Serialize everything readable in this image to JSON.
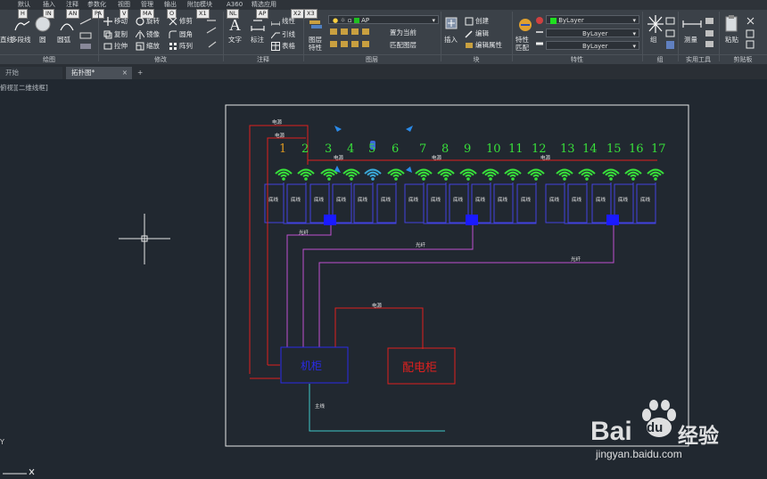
{
  "ribbon": {
    "tabs": [
      "默认",
      "插入",
      "注释",
      "参数化",
      "视图",
      "管理",
      "输出",
      "附加模块",
      "A360",
      "精选应用"
    ],
    "key_badges": [
      "H",
      "IN",
      "AN",
      "PA",
      "V",
      "MA",
      "O",
      "X1",
      "NL",
      "AP",
      "X2",
      "X3"
    ],
    "draw": {
      "line": "直线",
      "polyline": "多段线",
      "circle": "圆",
      "arc": "圆弧"
    },
    "modify": {
      "move": "移动",
      "rotate": "旋转",
      "trim": "修剪",
      "copy": "复制",
      "mirror": "镜像",
      "fillet": "圆角",
      "stretch": "拉伸",
      "scale": "缩放",
      "array": "阵列"
    },
    "annotation": {
      "text": "文字",
      "dimension": "标注",
      "linear": "线性",
      "leader": "引线",
      "table": "表格"
    },
    "layers": {
      "layer_props": "图层特性",
      "current_layer": "AP",
      "set_current": "置为当前",
      "match_layer": "匹配图层"
    },
    "block": {
      "insert": "插入",
      "create": "创建",
      "edit": "编辑",
      "edit_attr": "编辑属性"
    },
    "properties": {
      "match_props": "特性匹配",
      "color": "ByLayer",
      "linetype": "ByLayer",
      "lineweight": "ByLayer"
    },
    "extra": {
      "group": "组",
      "measure": "测量",
      "paste": "粘贴"
    },
    "sections": [
      "绘图",
      "修改",
      "注释",
      "图层",
      "块",
      "特性",
      "组",
      "实用工具",
      "剪贴板"
    ]
  },
  "doc_tabs": {
    "start": "开始",
    "current": "拓扑图*",
    "add": "+"
  },
  "viewport_label": "俯视][二维线框]",
  "drawing": {
    "ap_numbers": [
      "1",
      "2",
      "3",
      "4",
      "5",
      "6",
      "7",
      "8",
      "9",
      "10",
      "11",
      "12",
      "13",
      "14",
      "15",
      "16",
      "17"
    ],
    "cable_label": "底线",
    "power_label": "电源",
    "fiber_label": "光纤",
    "main_label": "主线",
    "cabinet_label": "机柜",
    "dist_cabinet_label": "配电柜"
  },
  "colors": {
    "ap_numbers": "#38e03a",
    "wifi": "#38e03a",
    "power": "#e0201e",
    "fiber": "#c050d0",
    "ethernet": "#4242e0",
    "switch": "#1a1aff",
    "main": "#40c8c8",
    "frame": "#e8e8e8"
  },
  "watermark": {
    "brand": "Bai",
    "brand2": "du",
    "cn": "经验",
    "url": "jingyan.baidu.com"
  },
  "axis_label": "Y"
}
